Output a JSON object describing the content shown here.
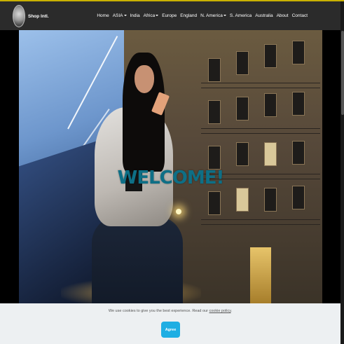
{
  "brand": {
    "name": "Shop Intl."
  },
  "nav": {
    "items": [
      {
        "label": "Home",
        "dropdown": false
      },
      {
        "label": "ASIA",
        "dropdown": true
      },
      {
        "label": "India",
        "dropdown": false
      },
      {
        "label": "Africa",
        "dropdown": true
      },
      {
        "label": "Europe",
        "dropdown": false
      },
      {
        "label": "England",
        "dropdown": false
      },
      {
        "label": "N. America",
        "dropdown": true
      },
      {
        "label": "S. America",
        "dropdown": false
      },
      {
        "label": "Australia",
        "dropdown": false
      },
      {
        "label": "About",
        "dropdown": false
      },
      {
        "label": "Contact",
        "dropdown": false
      }
    ]
  },
  "hero": {
    "headline": "WELCOME!",
    "headline_color": "#0e6f86"
  },
  "cookie": {
    "text": "We use cookies to give you the best experience. Read our",
    "link_label": "cookie policy",
    "text_end": ".",
    "agree_label": "Agree",
    "button_color": "#1eaee3"
  },
  "colors": {
    "top_accent": "#c9b100",
    "navbar_bg": "#2b2b2b",
    "cookie_bg": "#edf0f2"
  }
}
